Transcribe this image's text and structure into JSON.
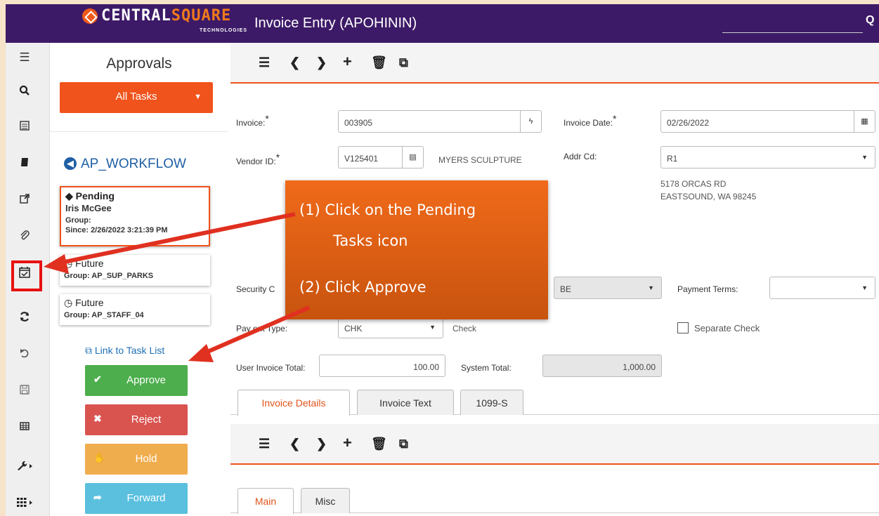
{
  "header": {
    "brand_main": "CENTRAL",
    "brand_accent": "SQUARE",
    "brand_sub": "TECHNOLOGIES",
    "app_title": "Invoice Entry (APOHININ)",
    "search_icon": "Q"
  },
  "rail": {
    "icons": [
      "menu-icon",
      "search-icon",
      "calendar-icon",
      "book-icon",
      "external-link-icon",
      "paperclip-icon",
      "pending-tasks-icon",
      "refresh-icon",
      "undo-icon",
      "save-icon",
      "table-icon",
      "wrench-icon",
      "grid-icon"
    ]
  },
  "panel": {
    "title": "Approvals",
    "all_tasks_label": "All Tasks",
    "workflow_label": "AP_WORKFLOW",
    "pending": {
      "title": "Pending",
      "name": "Iris McGee",
      "group_label": "Group:",
      "since": "Since: 2/26/2022 3:21:39 PM"
    },
    "future1": {
      "title": "Future",
      "group": "Group: AP_SUP_PARKS"
    },
    "future2": {
      "title": "Future",
      "group": "Group: AP_STAFF_04"
    },
    "link_task_list": "Link to Task List",
    "approve": "Approve",
    "reject": "Reject",
    "hold": "Hold",
    "forward": "Forward"
  },
  "form": {
    "invoice_label": "Invoice:",
    "invoice_value": "003905",
    "invoice_date_label": "Invoice Date:",
    "invoice_date_value": "02/26/2022",
    "vendor_label": "Vendor ID:",
    "vendor_value": "V125401",
    "vendor_name": "MYERS SCULPTURE",
    "addr_label": "Addr Cd:",
    "addr_value": "R1",
    "addr_line1": "5178 ORCAS RD",
    "addr_line2": "EASTSOUND, WA 98245",
    "security_label": "Security C",
    "security_value": "BE",
    "payment_terms_label": "Payment Terms:",
    "payment_type_label": "Pay    ent Type:",
    "payment_type_value": "CHK",
    "payment_type_desc": "Check",
    "separate_check_label": "Separate Check",
    "user_total_label": "User Invoice Total:",
    "user_total_value": "100.00",
    "system_total_label": "System Total:",
    "system_total_value": "1,000.00",
    "required_mark": "*"
  },
  "tabs": {
    "details": "Invoice Details",
    "text": "Invoice Text",
    "form1099": "1099-S",
    "main": "Main",
    "misc": "Misc"
  },
  "callout": {
    "step1a": "(1)  Click on the Pending",
    "step1b": "Tasks icon",
    "step2": "(2)  Click Approve"
  },
  "colors": {
    "header": "#3d1a67",
    "accent": "#f0531b",
    "approve": "#4cae4c",
    "reject": "#d9534f",
    "hold": "#f0ad4e",
    "forward": "#5bc0de",
    "annotation": "#e81010"
  }
}
